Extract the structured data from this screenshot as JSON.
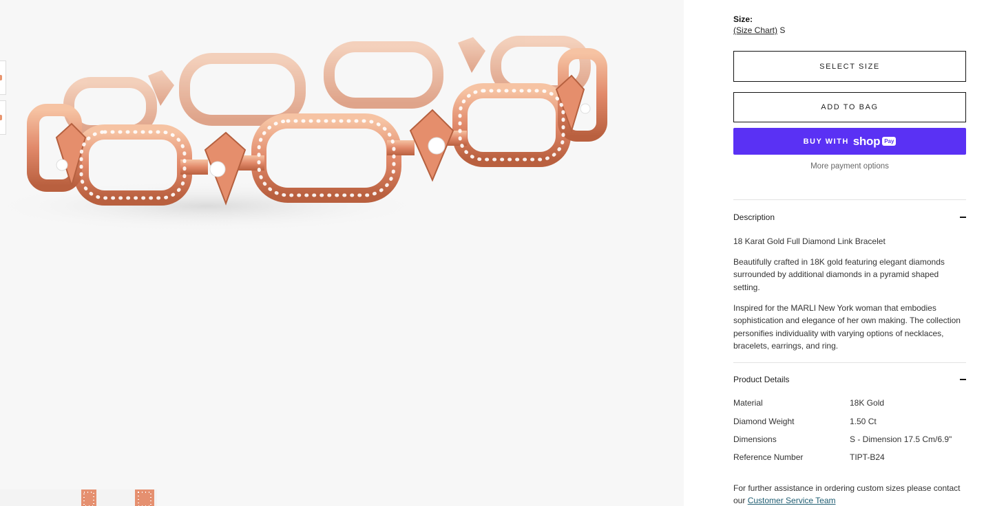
{
  "product": {
    "size_label": "Size:",
    "size_chart_label": "(Size Chart)",
    "selected_size": "S"
  },
  "actions": {
    "select_size_label": "SELECT SIZE",
    "add_to_bag_label": "ADD TO BAG",
    "buy_with_label": "BUY WITH",
    "shop_brand": "shop",
    "pay_badge": "Pay",
    "more_payment_label": "More payment options"
  },
  "description": {
    "heading": "Description",
    "toggle_icon": "minus-icon",
    "paragraphs": [
      "18 Karat Gold Full Diamond Link Bracelet",
      "Beautifully crafted in 18K gold featuring elegant diamonds surrounded by additional diamonds in a pyramid shaped setting.",
      "Inspired for the MARLI New York woman that embodies sophistication and elegance of her own making. The collection personifies individuality with varying options of necklaces, bracelets, earrings, and ring."
    ]
  },
  "product_details": {
    "heading": "Product Details",
    "toggle_icon": "minus-icon",
    "rows": [
      {
        "key": "Material",
        "value": "18K Gold"
      },
      {
        "key": "Diamond Weight",
        "value": "1.50 Ct"
      },
      {
        "key": "Dimensions",
        "value": "S - Dimension 17.5 Cm/6.9\""
      },
      {
        "key": "Reference Number",
        "value": "TIPT-B24"
      }
    ]
  },
  "assistance": {
    "text": "For further assistance in ordering custom sizes please contact our",
    "link_label": "Customer Service Team"
  },
  "colors": {
    "shop_pay_purple": "#5a31f4",
    "rose_gold": "#e8956f",
    "link_teal": "#1f5d72"
  }
}
